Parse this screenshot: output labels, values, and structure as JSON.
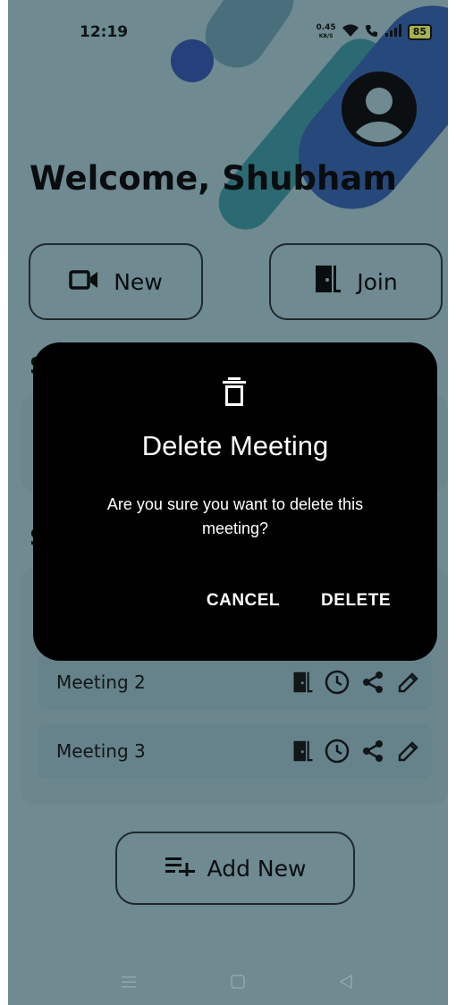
{
  "status_bar": {
    "time": "12:19",
    "net_speed_value": "0.45",
    "net_speed_unit": "KB/S",
    "battery": "85",
    "icons": [
      "wifi-icon",
      "volte-call-icon",
      "signal-icon",
      "battery-icon"
    ]
  },
  "header": {
    "welcome": "Welcome, Shubham",
    "avatar_icon": "account-circle-icon"
  },
  "actions": {
    "new_label": "New",
    "new_icon": "video-camera-icon",
    "join_label": "Join",
    "join_icon": "door-icon"
  },
  "section_peek": [
    "S",
    "S"
  ],
  "meetings": [
    {
      "name": "Meeting 2",
      "icons": [
        "door-icon",
        "clock-icon",
        "share-icon",
        "edit-icon"
      ]
    },
    {
      "name": "Meeting 3",
      "icons": [
        "door-icon",
        "clock-icon",
        "share-icon",
        "edit-icon"
      ]
    }
  ],
  "add_new": {
    "label": "Add New",
    "icon": "playlist-add-icon"
  },
  "dialog": {
    "icon": "trash-icon",
    "title": "Delete Meeting",
    "message": "Are you sure you want to delete this meeting?",
    "cancel": "CANCEL",
    "delete": "DELETE"
  },
  "nav_bar": {
    "icons": [
      "menu-icon",
      "home-square-icon",
      "back-triangle-icon"
    ]
  },
  "colors": {
    "scrim_background": "#6f8a91",
    "dialog_background": "#000000",
    "dialog_text": "#ffffff",
    "text_dark": "#0a0d0f"
  }
}
